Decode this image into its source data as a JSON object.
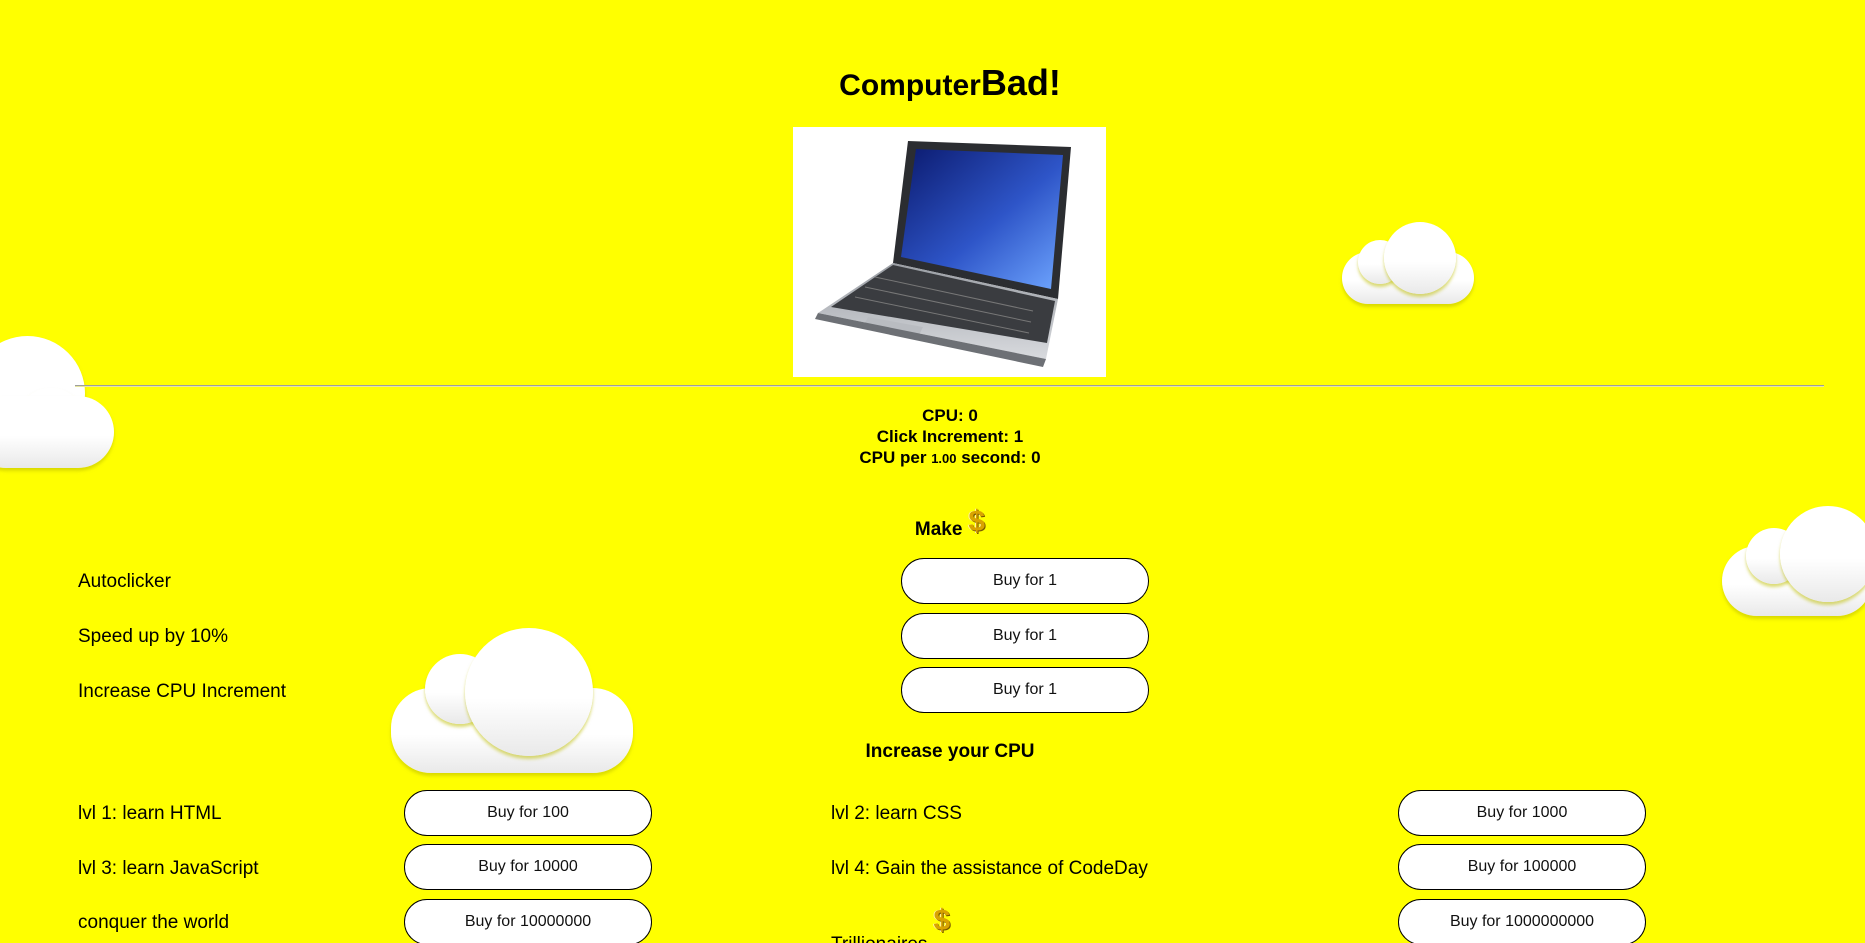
{
  "header": {
    "title_small": "Computer",
    "title_big": "Bad!"
  },
  "laptop": {
    "image_name": "laptop-clickable-image"
  },
  "stats": {
    "cpu_label": "CPU: ",
    "cpu_value": "0",
    "click_increment_label": "Click Increment: ",
    "click_increment_value": "1",
    "cpu_per_label": "CPU per ",
    "cpu_per_interval": "1.00",
    "cpu_per_suffix": " second: ",
    "cpu_per_value": "0"
  },
  "make": {
    "heading": "Make",
    "items": [
      {
        "label": "Autoclicker",
        "button": "Buy for 1"
      },
      {
        "label": "Speed up by 10%",
        "button": "Buy for 1"
      },
      {
        "label": "Increase CPU Increment",
        "button": "Buy for 1"
      }
    ]
  },
  "cpu": {
    "heading": "Increase your CPU",
    "items": [
      {
        "label": "lvl 1: learn HTML",
        "button": "Buy for 100"
      },
      {
        "label": "lvl 2: learn CSS",
        "button": "Buy for 1000"
      },
      {
        "label": "lvl 3: learn JavaScript",
        "button": "Buy for 10000"
      },
      {
        "label": "lvl 4: Gain the assistance of CodeDay",
        "button": "Buy for 100000"
      },
      {
        "label": "conquer the world",
        "button": "Buy for 10000000"
      },
      {
        "label": "Trillionaires",
        "button": "Buy for 1000000000"
      }
    ]
  },
  "icons": {
    "dollar": "$"
  },
  "colors": {
    "background": "#ffff00",
    "button_bg": "#ffffff",
    "cloud": "#ffffff"
  }
}
